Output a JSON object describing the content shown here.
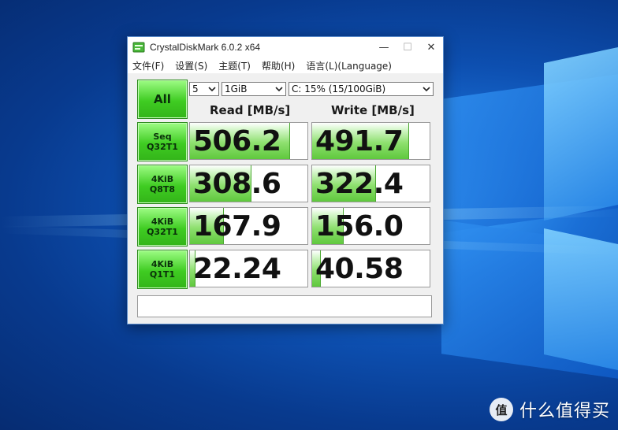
{
  "window": {
    "title": "CrystalDiskMark 6.0.2 x64",
    "minimize_label": "—",
    "maximize_label": "☐",
    "close_label": "✕"
  },
  "menu": [
    "文件(F)",
    "设置(S)",
    "主题(T)",
    "帮助(H)",
    "语言(L)(Language)"
  ],
  "controls": {
    "all_button": "All",
    "test_count": "5",
    "test_size": "1GiB",
    "drive": "C: 15% (15/100GiB)"
  },
  "headers": {
    "read": "Read [MB/s]",
    "write": "Write [MB/s]"
  },
  "max_scale": 600,
  "rows": [
    {
      "line1": "Seq",
      "line2": "Q32T1",
      "read": "506.2",
      "write": "491.7"
    },
    {
      "line1": "4KiB",
      "line2": "Q8T8",
      "read": "308.6",
      "write": "322.4"
    },
    {
      "line1": "4KiB",
      "line2": "Q32T1",
      "read": "167.9",
      "write": "156.0"
    },
    {
      "line1": "4KiB",
      "line2": "Q1T1",
      "read": "22.24",
      "write": "40.58"
    }
  ],
  "comment": "",
  "watermark": {
    "text": "什么值得买",
    "logo_text": "值"
  },
  "colors": {
    "accent_green": "#3fcc22",
    "bar_green": "#8ee06f"
  }
}
